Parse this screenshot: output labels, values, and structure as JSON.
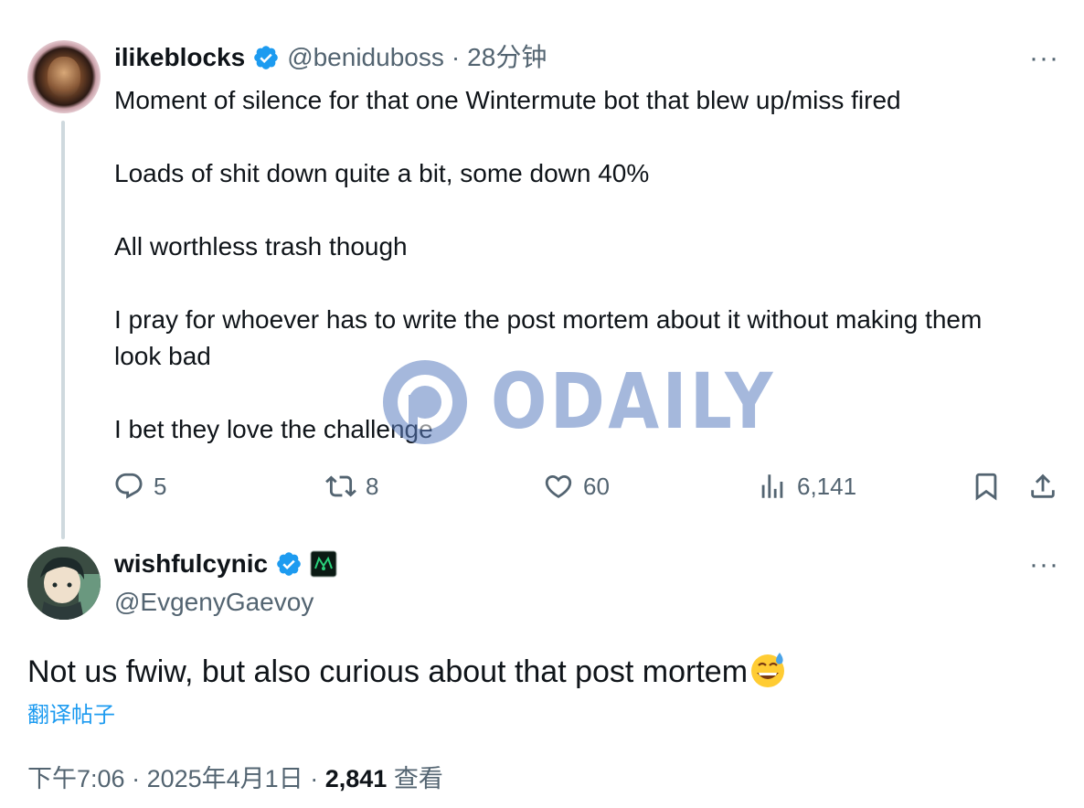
{
  "parent_tweet": {
    "display_name": "ilikeblocks",
    "handle": "@beniduboss",
    "separator": "·",
    "time_ago": "28分钟",
    "more_label": "···",
    "paragraphs": [
      "Moment of silence for that one Wintermute bot that blew up/miss fired",
      "Loads of shit down quite a bit, some down 40%",
      "All worthless trash though",
      "I pray for whoever has to write the post mortem about it without making them look bad",
      "I bet they love the challenge"
    ],
    "actions": {
      "replies": "5",
      "retweets": "8",
      "likes": "60",
      "views": "6,141"
    }
  },
  "watermark": {
    "text": "ODAILY"
  },
  "reply_tweet": {
    "display_name": "wishfulcynic",
    "handle": "@EvgenyGaevoy",
    "more_label": "···",
    "text": "Not us fwiw, but also curious about that post mortem",
    "emoji": "grinning-face-with-sweat",
    "translate_label": "翻译帖子",
    "time": "下午7:06",
    "separator": "·",
    "date": "2025年4月1日",
    "views_count": "2,841",
    "views_label": "查看"
  },
  "colors": {
    "text": "#0f1419",
    "secondary": "#536471",
    "verified": "#1d9bf0",
    "link": "#1d9bf0",
    "thread_line": "#cfd9de",
    "watermark": "#5c7fc0"
  }
}
